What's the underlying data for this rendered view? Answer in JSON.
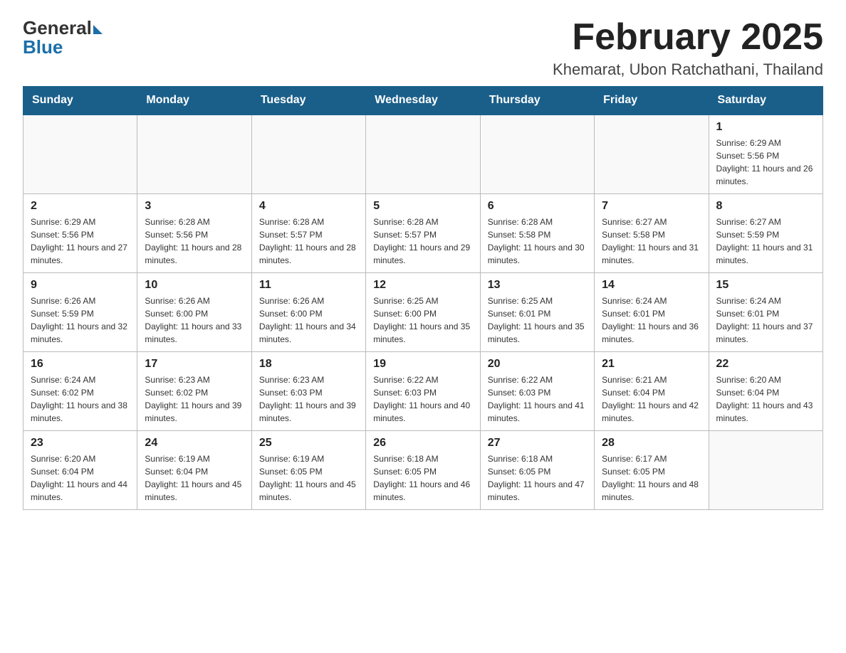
{
  "header": {
    "logo_general": "General",
    "logo_blue": "Blue",
    "month_title": "February 2025",
    "location": "Khemarat, Ubon Ratchathani, Thailand"
  },
  "weekdays": [
    "Sunday",
    "Monday",
    "Tuesday",
    "Wednesday",
    "Thursday",
    "Friday",
    "Saturday"
  ],
  "weeks": [
    [
      {
        "day": "",
        "info": ""
      },
      {
        "day": "",
        "info": ""
      },
      {
        "day": "",
        "info": ""
      },
      {
        "day": "",
        "info": ""
      },
      {
        "day": "",
        "info": ""
      },
      {
        "day": "",
        "info": ""
      },
      {
        "day": "1",
        "info": "Sunrise: 6:29 AM\nSunset: 5:56 PM\nDaylight: 11 hours and 26 minutes."
      }
    ],
    [
      {
        "day": "2",
        "info": "Sunrise: 6:29 AM\nSunset: 5:56 PM\nDaylight: 11 hours and 27 minutes."
      },
      {
        "day": "3",
        "info": "Sunrise: 6:28 AM\nSunset: 5:56 PM\nDaylight: 11 hours and 28 minutes."
      },
      {
        "day": "4",
        "info": "Sunrise: 6:28 AM\nSunset: 5:57 PM\nDaylight: 11 hours and 28 minutes."
      },
      {
        "day": "5",
        "info": "Sunrise: 6:28 AM\nSunset: 5:57 PM\nDaylight: 11 hours and 29 minutes."
      },
      {
        "day": "6",
        "info": "Sunrise: 6:28 AM\nSunset: 5:58 PM\nDaylight: 11 hours and 30 minutes."
      },
      {
        "day": "7",
        "info": "Sunrise: 6:27 AM\nSunset: 5:58 PM\nDaylight: 11 hours and 31 minutes."
      },
      {
        "day": "8",
        "info": "Sunrise: 6:27 AM\nSunset: 5:59 PM\nDaylight: 11 hours and 31 minutes."
      }
    ],
    [
      {
        "day": "9",
        "info": "Sunrise: 6:26 AM\nSunset: 5:59 PM\nDaylight: 11 hours and 32 minutes."
      },
      {
        "day": "10",
        "info": "Sunrise: 6:26 AM\nSunset: 6:00 PM\nDaylight: 11 hours and 33 minutes."
      },
      {
        "day": "11",
        "info": "Sunrise: 6:26 AM\nSunset: 6:00 PM\nDaylight: 11 hours and 34 minutes."
      },
      {
        "day": "12",
        "info": "Sunrise: 6:25 AM\nSunset: 6:00 PM\nDaylight: 11 hours and 35 minutes."
      },
      {
        "day": "13",
        "info": "Sunrise: 6:25 AM\nSunset: 6:01 PM\nDaylight: 11 hours and 35 minutes."
      },
      {
        "day": "14",
        "info": "Sunrise: 6:24 AM\nSunset: 6:01 PM\nDaylight: 11 hours and 36 minutes."
      },
      {
        "day": "15",
        "info": "Sunrise: 6:24 AM\nSunset: 6:01 PM\nDaylight: 11 hours and 37 minutes."
      }
    ],
    [
      {
        "day": "16",
        "info": "Sunrise: 6:24 AM\nSunset: 6:02 PM\nDaylight: 11 hours and 38 minutes."
      },
      {
        "day": "17",
        "info": "Sunrise: 6:23 AM\nSunset: 6:02 PM\nDaylight: 11 hours and 39 minutes."
      },
      {
        "day": "18",
        "info": "Sunrise: 6:23 AM\nSunset: 6:03 PM\nDaylight: 11 hours and 39 minutes."
      },
      {
        "day": "19",
        "info": "Sunrise: 6:22 AM\nSunset: 6:03 PM\nDaylight: 11 hours and 40 minutes."
      },
      {
        "day": "20",
        "info": "Sunrise: 6:22 AM\nSunset: 6:03 PM\nDaylight: 11 hours and 41 minutes."
      },
      {
        "day": "21",
        "info": "Sunrise: 6:21 AM\nSunset: 6:04 PM\nDaylight: 11 hours and 42 minutes."
      },
      {
        "day": "22",
        "info": "Sunrise: 6:20 AM\nSunset: 6:04 PM\nDaylight: 11 hours and 43 minutes."
      }
    ],
    [
      {
        "day": "23",
        "info": "Sunrise: 6:20 AM\nSunset: 6:04 PM\nDaylight: 11 hours and 44 minutes."
      },
      {
        "day": "24",
        "info": "Sunrise: 6:19 AM\nSunset: 6:04 PM\nDaylight: 11 hours and 45 minutes."
      },
      {
        "day": "25",
        "info": "Sunrise: 6:19 AM\nSunset: 6:05 PM\nDaylight: 11 hours and 45 minutes."
      },
      {
        "day": "26",
        "info": "Sunrise: 6:18 AM\nSunset: 6:05 PM\nDaylight: 11 hours and 46 minutes."
      },
      {
        "day": "27",
        "info": "Sunrise: 6:18 AM\nSunset: 6:05 PM\nDaylight: 11 hours and 47 minutes."
      },
      {
        "day": "28",
        "info": "Sunrise: 6:17 AM\nSunset: 6:05 PM\nDaylight: 11 hours and 48 minutes."
      },
      {
        "day": "",
        "info": ""
      }
    ]
  ]
}
